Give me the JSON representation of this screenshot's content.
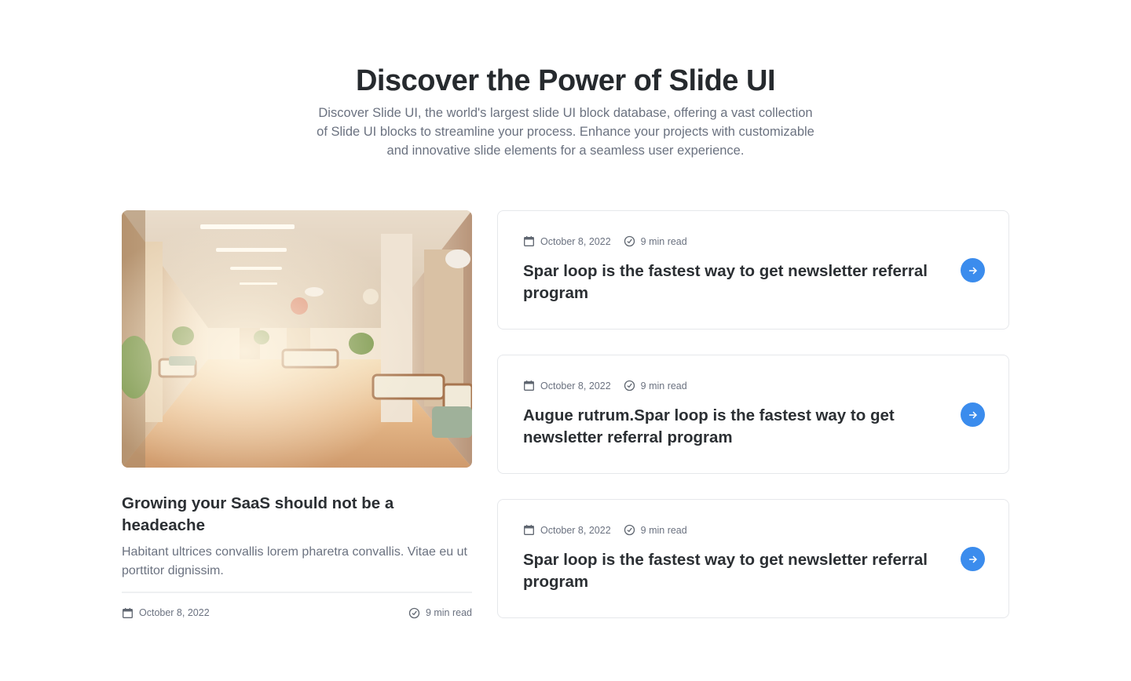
{
  "hero": {
    "title": "Discover the Power of Slide UI",
    "subtitle": "Discover Slide UI, the world's largest slide UI block database, offering a vast collection of Slide UI blocks to streamline your process. Enhance your projects with customizable and innovative slide elements for a seamless user experience."
  },
  "feature": {
    "image_alt": "Bright hospital waiting room corridor with chairs and plants",
    "title": "Growing your SaaS should not be a headeache",
    "description": "Habitant ultrices convallis lorem pharetra convallis. Vitae eu ut porttitor dignissim.",
    "date": "October 8, 2022",
    "read_time": "9 min read"
  },
  "cards": [
    {
      "date": "October 8, 2022",
      "read_time": "9 min read",
      "title": "Spar loop is the fastest way to get newsletter referral program"
    },
    {
      "date": "October 8, 2022",
      "read_time": "9 min read",
      "title": "Augue rutrum.Spar loop is the fastest way to get newsletter referral program"
    },
    {
      "date": "October 8, 2022",
      "read_time": "9 min read",
      "title": "Spar loop is the fastest way to get newsletter referral program"
    }
  ],
  "icons": {
    "calendar": "calendar-icon",
    "clock": "clock-icon",
    "arrow": "arrow-right-icon"
  },
  "colors": {
    "accent": "#3b8ced",
    "heading": "#262a2e",
    "muted": "#6b7280",
    "border": "#e6e8eb"
  }
}
